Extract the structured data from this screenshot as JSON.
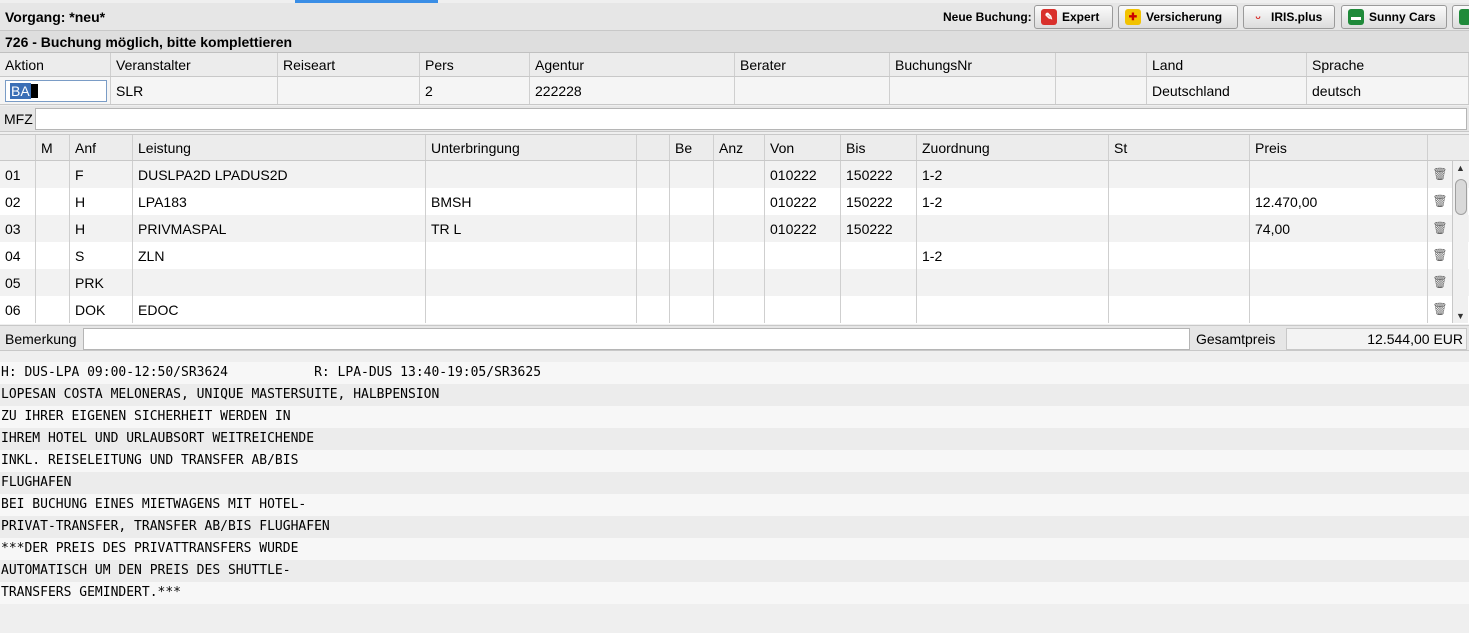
{
  "header": {
    "title": "Vorgang: *neu*",
    "neue_buchung_label": "Neue Buchung:",
    "buttons": [
      "Expert",
      "Versicherung",
      "IRIS.plus",
      "Sunny Cars"
    ]
  },
  "status": "726 - Buchung möglich, bitte komplettieren",
  "booking": {
    "headers": [
      "Aktion",
      "Veranstalter",
      "Reiseart",
      "Pers",
      "Agentur",
      "Berater",
      "BuchungsNr",
      "",
      "Land",
      "Sprache"
    ],
    "aktion_value": "BA",
    "values": [
      "",
      "SLR",
      "",
      "2",
      "222228",
      "",
      "",
      "",
      "Deutschland",
      "deutsch"
    ]
  },
  "mfz": {
    "label": "MFZ",
    "value": ""
  },
  "services": {
    "headers": [
      "",
      "M",
      "Anf",
      "Leistung",
      "Unterbringung",
      "",
      "Be",
      "Anz",
      "Von",
      "Bis",
      "Zuordnung",
      "St",
      "Preis"
    ],
    "rows": [
      [
        "01",
        "",
        "F",
        "DUSLPA2D LPADUS2D",
        "",
        "",
        "",
        "",
        "010222",
        "150222",
        "1-2",
        "",
        ""
      ],
      [
        "02",
        "",
        "H",
        "LPA183",
        "BMSH",
        "",
        "",
        "",
        "010222",
        "150222",
        "1-2",
        "",
        "12.470,00"
      ],
      [
        "03",
        "",
        "H",
        "PRIVMASPAL",
        "TR L",
        "",
        "",
        "",
        "010222",
        "150222",
        "",
        "",
        "74,00"
      ],
      [
        "04",
        "",
        "S",
        "ZLN",
        "",
        "",
        "",
        "",
        "",
        "",
        "1-2",
        "",
        ""
      ],
      [
        "05",
        "",
        "PRK",
        "",
        "",
        "",
        "",
        "",
        "",
        "",
        "",
        "",
        ""
      ],
      [
        "06",
        "",
        "DOK",
        "EDOC",
        "",
        "",
        "",
        "",
        "",
        "",
        "",
        "",
        ""
      ]
    ]
  },
  "footer": {
    "bemerkung_label": "Bemerkung",
    "bemerkung_value": "",
    "gesamtpreis_label": "Gesamtpreis",
    "gesamtpreis_value": "12.544,00 EUR"
  },
  "text_lines": [
    "H: DUS-LPA 09:00-12:50/SR3624           R: LPA-DUS 13:40-19:05/SR3625",
    "LOPESAN COSTA MELONERAS, UNIQUE MASTERSUITE, HALBPENSION",
    "ZU IHRER EIGENEN SICHERHEIT WERDEN IN",
    "IHREM HOTEL UND URLAUBSORT WEITREICHENDE",
    "INKL. REISELEITUNG UND TRANSFER AB/BIS",
    "FLUGHAFEN",
    "BEI BUCHUNG EINES MIETWAGENS MIT HOTEL-",
    "PRIVAT-TRANSFER, TRANSFER AB/BIS FLUGHAFEN",
    "***DER PREIS DES PRIVATTRANSFERS WURDE",
    "AUTOMATISCH UM DEN PREIS DES SHUTTLE-",
    "TRANSFERS GEMINDERT.***"
  ]
}
